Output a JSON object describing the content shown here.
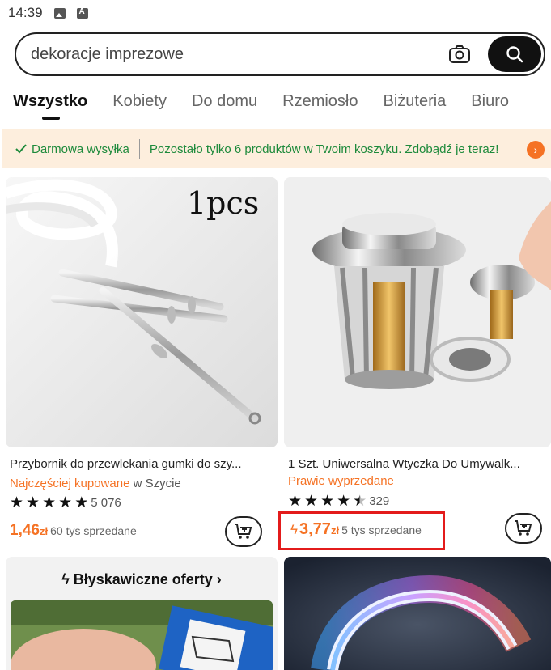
{
  "status_bar": {
    "time": "14:39"
  },
  "search": {
    "value": "dekoracje imprezowe"
  },
  "tabs": [
    {
      "label": "Wszystko",
      "active": true
    },
    {
      "label": "Kobiety"
    },
    {
      "label": "Do domu"
    },
    {
      "label": "Rzemiosło"
    },
    {
      "label": "Biżuteria"
    },
    {
      "label": "Biuro"
    }
  ],
  "promo": {
    "shipping_label": "Darmowa wysyłka",
    "message": "Pozostało tylko 6 produktów w Twoim koszyku. Zdobądź je teraz!"
  },
  "products": [
    {
      "image_label": "1pcs",
      "title": "Przybornik do przewlekania gumki do szy...",
      "tag": "Najczęściej kupowane",
      "tag_suffix": " w Szycie",
      "rating": 5,
      "review_count": "5 076",
      "price_main": "1,46",
      "currency": "zł",
      "sold": "60 tys sprzedane"
    },
    {
      "title": "1 Szt. Uniwersalna Wtyczka Do Umywalk...",
      "tag": "Prawie wyprzedane",
      "rating": 4.5,
      "review_count": "329",
      "price_main": "3,77",
      "currency": "zł",
      "sold": "5 tys sprzedane"
    }
  ],
  "flash": {
    "title": "Błyskawiczne oferty"
  },
  "colors": {
    "accent": "#f57224",
    "promo_green": "#1d8a3b",
    "highlight": "#e31b1b"
  }
}
